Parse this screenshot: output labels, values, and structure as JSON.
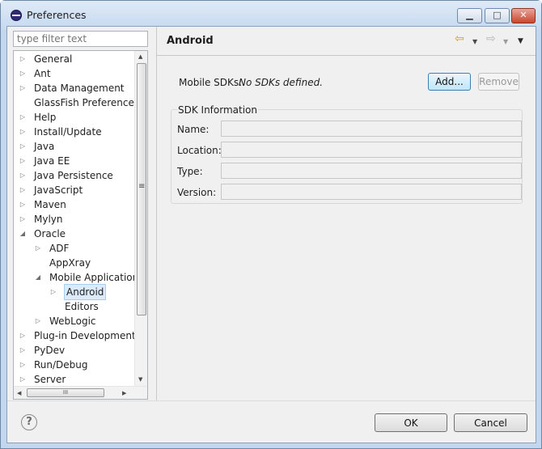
{
  "window": {
    "title": "Preferences",
    "minimize": "▁",
    "maximize": "□",
    "close": "✕"
  },
  "filter": {
    "placeholder": "type filter text"
  },
  "tree": {
    "items": [
      {
        "label": "General",
        "toggle": "▷"
      },
      {
        "label": "Ant",
        "toggle": "▷"
      },
      {
        "label": "Data Management",
        "toggle": "▷"
      },
      {
        "label": "GlassFish Preferences",
        "toggle": ""
      },
      {
        "label": "Help",
        "toggle": "▷"
      },
      {
        "label": "Install/Update",
        "toggle": "▷"
      },
      {
        "label": "Java",
        "toggle": "▷"
      },
      {
        "label": "Java EE",
        "toggle": "▷"
      },
      {
        "label": "Java Persistence",
        "toggle": "▷"
      },
      {
        "label": "JavaScript",
        "toggle": "▷"
      },
      {
        "label": "Maven",
        "toggle": "▷"
      },
      {
        "label": "Mylyn",
        "toggle": "▷"
      },
      {
        "label": "Oracle",
        "toggle": "◢"
      },
      {
        "label": "ADF",
        "toggle": "▷"
      },
      {
        "label": "AppXray",
        "toggle": ""
      },
      {
        "label": "Mobile Application I",
        "toggle": "◢"
      },
      {
        "label": "Android",
        "toggle": "▷"
      },
      {
        "label": "Editors",
        "toggle": ""
      },
      {
        "label": "WebLogic",
        "toggle": "▷"
      },
      {
        "label": "Plug-in Development",
        "toggle": "▷"
      },
      {
        "label": "PyDev",
        "toggle": "▷"
      },
      {
        "label": "Run/Debug",
        "toggle": "▷"
      },
      {
        "label": "Server",
        "toggle": "▷"
      }
    ],
    "selected_index": 16,
    "scroll_up": "▲",
    "scroll_down": "▼",
    "scroll_left": "◀",
    "scroll_right": "▶",
    "grip": "≡",
    "hgrip": "III"
  },
  "page": {
    "title": "Android",
    "nav_back_icon": "⇦",
    "nav_forward_icon": "⇨",
    "dropdown_icon": "▼",
    "menu_icon": "▼",
    "mobile_sdks_label": "Mobile SDKs:",
    "mobile_sdks_value": "No SDKs defined.",
    "add_label": "Add...",
    "remove_label": "Remove",
    "sdk_info_label": "SDK Information",
    "fields": [
      {
        "label": "Name:",
        "value": ""
      },
      {
        "label": "Location:",
        "value": ""
      },
      {
        "label": "Type:",
        "value": ""
      },
      {
        "label": "Version:",
        "value": ""
      }
    ]
  },
  "footer": {
    "help_icon": "?",
    "ok_label": "OK",
    "cancel_label": "Cancel"
  }
}
